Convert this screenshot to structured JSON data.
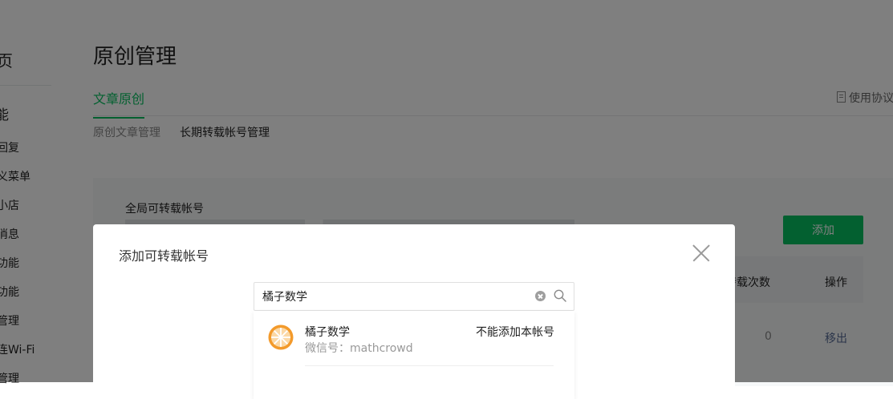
{
  "sidebar": {
    "top_label": "页",
    "section_label": "能",
    "items": [
      "回复",
      "义菜单",
      "小店",
      "消息",
      "功能",
      "功能",
      "管理",
      "连Wi-Fi",
      "管理"
    ]
  },
  "page": {
    "title": "原创管理",
    "tab_active": "文章原创",
    "protocol_link": "使用协议",
    "subnav": [
      "原创文章管理",
      "长期转载帐号管理"
    ]
  },
  "panel": {
    "title": "全局可转载帐号",
    "add_button": "添加",
    "table_headers": {
      "count": "转载次数",
      "operation": "操作"
    },
    "row": {
      "count": "0",
      "operation": "移出"
    }
  },
  "dialog": {
    "title": "添加可转载帐号",
    "search_value": "橘子数学",
    "result": {
      "name": "橘子数学",
      "wechat_id": "微信号：mathcrowd",
      "status": "不能添加本帐号"
    }
  },
  "colors": {
    "accent": "#07c160",
    "link": "#576b95",
    "overlay": "rgba(0,0,0,0.5)",
    "avatar_orange": "#f39a2b"
  }
}
